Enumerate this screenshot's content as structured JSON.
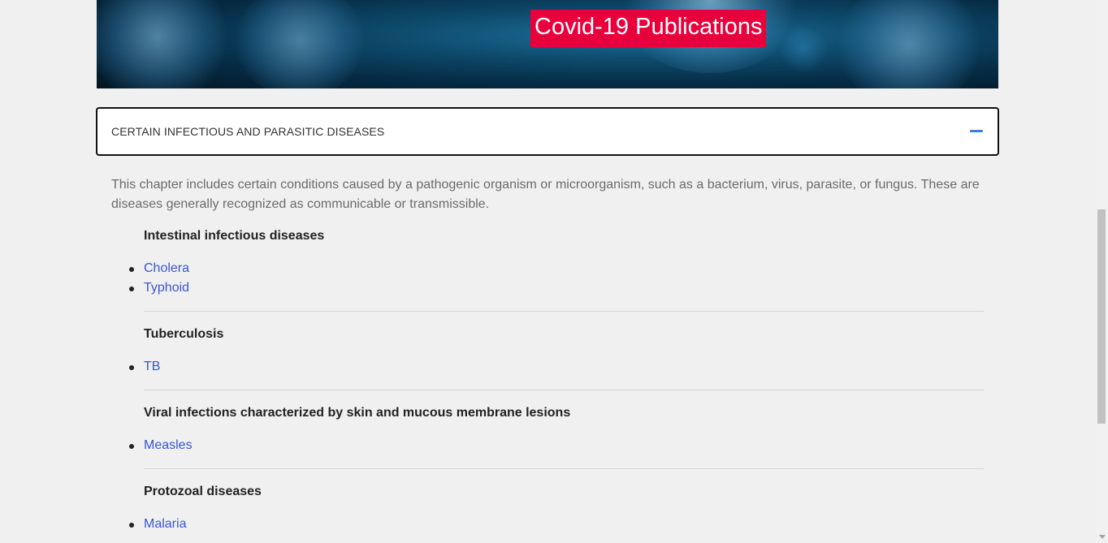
{
  "banner": {
    "title": "Covid-19 Publications"
  },
  "accordion": {
    "title": "CERTAIN INFECTIOUS AND PARASITIC DISEASES",
    "icon": "minus-icon",
    "intro": "This chapter includes certain conditions caused by a pathogenic organism or microorganism, such as a bacterium, virus, parasite, or fungus. These are diseases generally recognized as communicable or transmissible."
  },
  "sections": [
    {
      "heading": "Intestinal infectious diseases",
      "links": [
        "Cholera",
        "Typhoid"
      ]
    },
    {
      "heading": "Tuberculosis",
      "links": [
        "TB"
      ]
    },
    {
      "heading": "Viral infections characterized by skin and mucous membrane lesions",
      "links": [
        "Measles"
      ]
    },
    {
      "heading": "Protozoal diseases",
      "links": [
        "Malaria"
      ]
    }
  ],
  "colors": {
    "accent": "#3b7fd9",
    "link": "#3a55d6",
    "banner_badge": "#e8003c"
  }
}
